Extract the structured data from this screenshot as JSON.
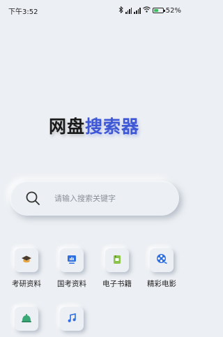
{
  "status_bar": {
    "time": "下午3:52",
    "battery_percent": "52",
    "battery_level": 0.52,
    "icons": [
      "bluetooth-icon",
      "signal-icon",
      "signal-icon",
      "wifi-icon",
      "battery-icon"
    ]
  },
  "header": {
    "title_part1": "网盘",
    "title_part2": "搜索器",
    "title_part2_color": "#3d57d6"
  },
  "search": {
    "placeholder": "请输入搜索关键字",
    "value": ""
  },
  "categories": [
    {
      "label": "考研资料",
      "icon": "graduation-cap-icon",
      "color": "#e8a33a"
    },
    {
      "label": "国考资料",
      "icon": "presentation-icon",
      "color": "#2f6fe0"
    },
    {
      "label": "电子书籍",
      "icon": "book-icon",
      "color": "#8bc34a"
    },
    {
      "label": "精彩电影",
      "icon": "film-reel-icon",
      "color": "#2f6fe0"
    },
    {
      "label": "",
      "icon": "bell-icon",
      "color": "#3aa877"
    },
    {
      "label": "",
      "icon": "music-note-icon",
      "color": "#2f6fe0"
    }
  ]
}
